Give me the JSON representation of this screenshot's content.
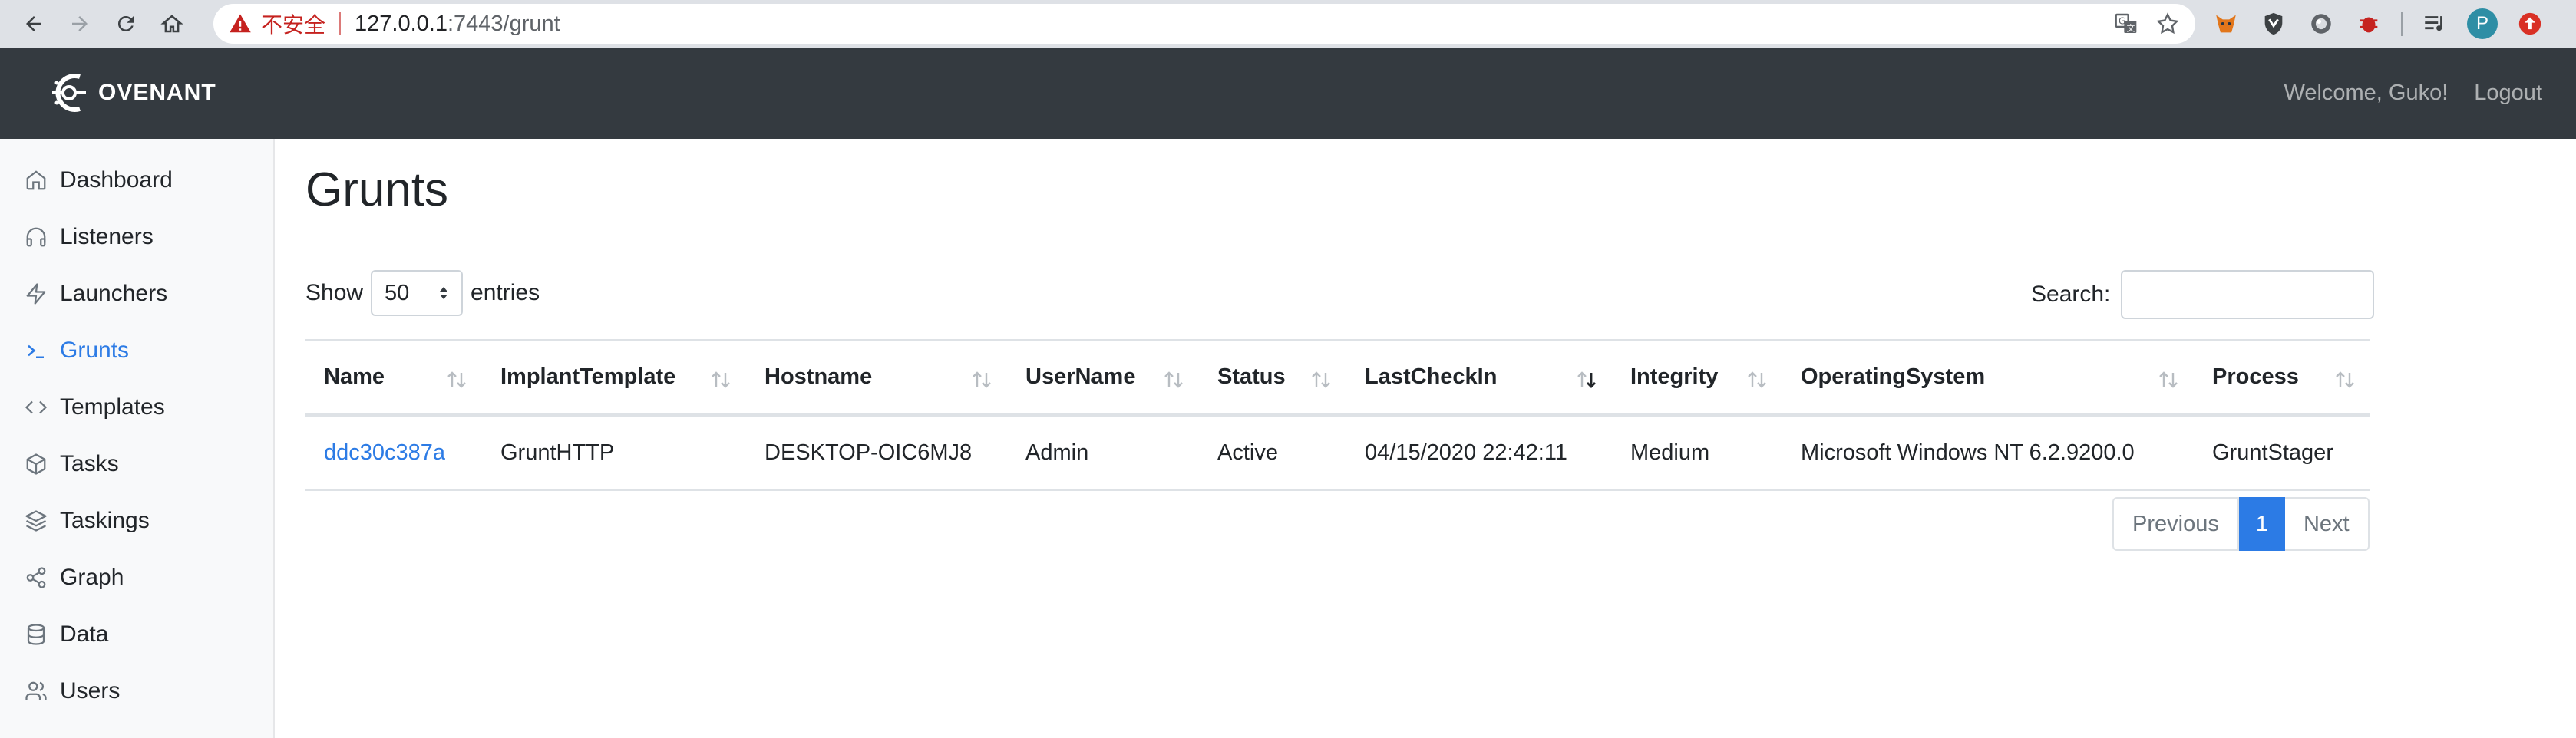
{
  "browser": {
    "insecure_label": "不安全",
    "url_host": "127.0.0.1",
    "url_path": ":7443/grunt",
    "profile_initial": "P"
  },
  "app": {
    "brand": "OVENANT",
    "welcome": "Welcome, Guko!",
    "logout": "Logout"
  },
  "sidebar": {
    "items": [
      {
        "label": "Dashboard",
        "icon": "home-icon"
      },
      {
        "label": "Listeners",
        "icon": "headphones-icon"
      },
      {
        "label": "Launchers",
        "icon": "zap-icon"
      },
      {
        "label": "Grunts",
        "icon": "terminal-icon"
      },
      {
        "label": "Templates",
        "icon": "code-icon"
      },
      {
        "label": "Tasks",
        "icon": "box-icon"
      },
      {
        "label": "Taskings",
        "icon": "layers-icon"
      },
      {
        "label": "Graph",
        "icon": "share-icon"
      },
      {
        "label": "Data",
        "icon": "database-icon"
      },
      {
        "label": "Users",
        "icon": "users-icon"
      }
    ],
    "active": "Grunts"
  },
  "page": {
    "title": "Grunts",
    "show_label": "Show",
    "entries_value": "50",
    "entries_label": "entries",
    "search_label": "Search:",
    "search_value": ""
  },
  "table": {
    "columns": [
      "Name",
      "ImplantTemplate",
      "Hostname",
      "UserName",
      "Status",
      "LastCheckIn",
      "Integrity",
      "OperatingSystem",
      "Process"
    ],
    "sorted_column": "LastCheckIn",
    "rows": [
      [
        "ddc30c387a",
        "GruntHTTP",
        "DESKTOP-OIC6MJ8",
        "Admin",
        "Active",
        "04/15/2020 22:42:11",
        "Medium",
        "Microsoft Windows NT 6.2.9200.0",
        "GruntStager"
      ]
    ]
  },
  "pagination": {
    "previous": "Previous",
    "current": "1",
    "next": "Next"
  },
  "colors": {
    "navbar": "#343a40",
    "accent": "#2c7be5",
    "sidebar_bg": "#f8f9fa"
  }
}
